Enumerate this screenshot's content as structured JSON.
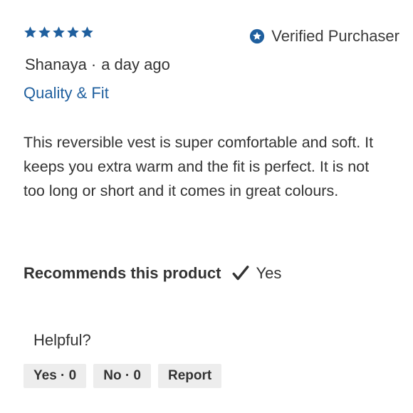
{
  "review": {
    "rating": 5,
    "rating_max": 5,
    "star_color": "#1f5f9e",
    "verified_label": "Verified Purchaser",
    "author": "Shanaya",
    "separator": "·",
    "time_ago": "a day ago",
    "category": "Quality & Fit",
    "text": "This reversible vest is super comfortable and soft. It keeps you extra warm and the fit is perfect. It is not too long or short and it comes in great colours.",
    "recommend_label": "Recommends this product",
    "recommend_value": "Yes"
  },
  "feedback": {
    "prompt": "Helpful?",
    "yes_label": "Yes · 0",
    "no_label": "No · 0",
    "report_label": "Report"
  }
}
